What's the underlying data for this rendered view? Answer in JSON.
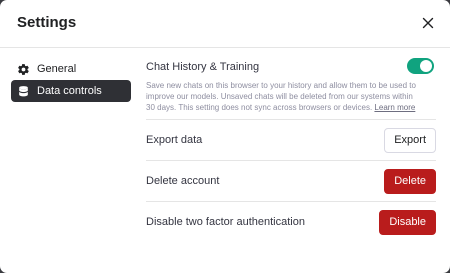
{
  "dialog": {
    "title": "Settings",
    "close_icon": "close-icon"
  },
  "sidebar": {
    "items": [
      {
        "label": "General",
        "icon": "gear-icon",
        "active": false
      },
      {
        "label": "Data controls",
        "icon": "database-icon",
        "active": true
      }
    ]
  },
  "content": {
    "chat_history": {
      "label": "Chat History & Training",
      "enabled": true,
      "description": "Save new chats on this browser to your history and allow them to be used to improve our models. Unsaved chats will be deleted from our systems within 30 days. This setting does not sync across browsers or devices.",
      "link_text": "Learn more"
    },
    "export": {
      "label": "Export data",
      "button": "Export"
    },
    "delete": {
      "label": "Delete account",
      "button": "Delete"
    },
    "two_factor": {
      "label": "Disable two factor authentication",
      "button": "Disable"
    }
  },
  "colors": {
    "accent": "#10a37f",
    "danger": "#b91c1c",
    "active_nav": "#2f3035"
  }
}
